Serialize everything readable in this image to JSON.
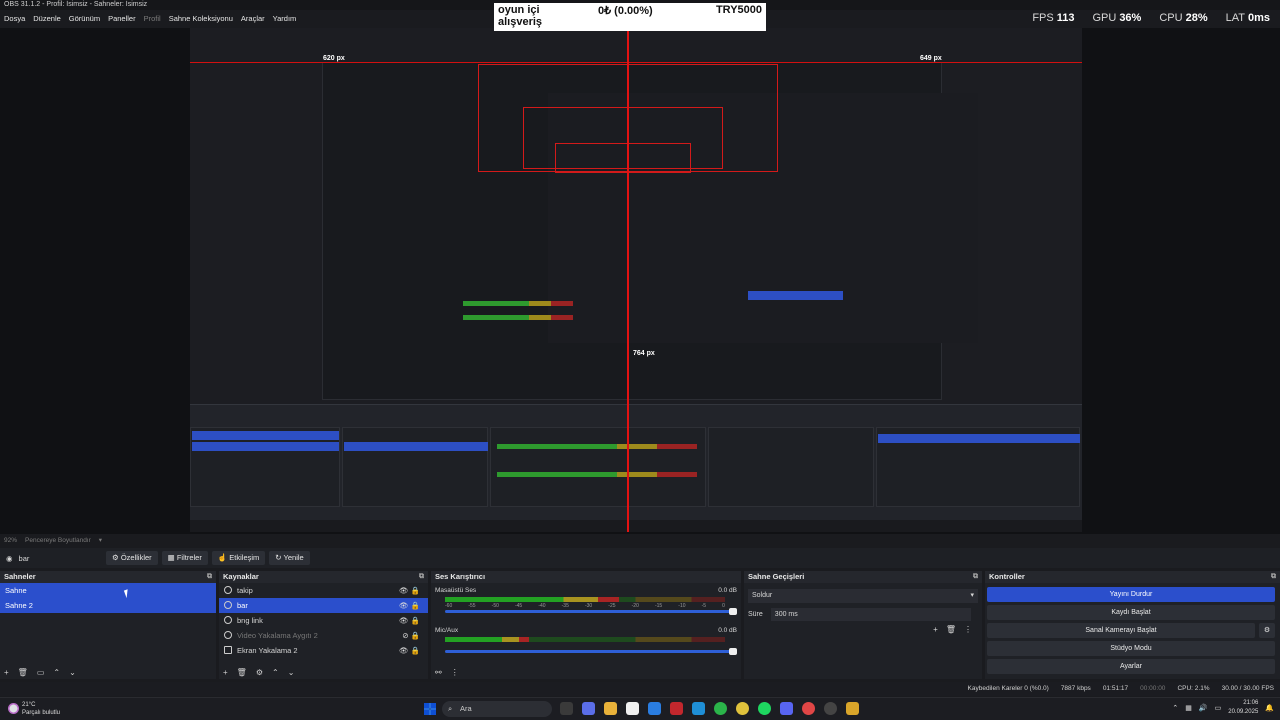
{
  "window": {
    "title": "OBS 31.1.2 - Profil: İsimsiz - Sahneler: İsimsiz"
  },
  "menu": [
    "Dosya",
    "Düzenle",
    "Görünüm",
    "Paneller",
    "Profil",
    "Sahne Koleksiyonu",
    "Araçlar",
    "Yardım"
  ],
  "popup": {
    "label": "oyun içi alışveriş",
    "amount": "0₺ (0.00%)",
    "goal": "TRY5000"
  },
  "stats": {
    "fps_label": "FPS",
    "fps": "113",
    "gpu_label": "GPU",
    "gpu": "36%",
    "cpu_label": "CPU",
    "cpu": "28%",
    "lat_label": "LAT",
    "lat": "0ms"
  },
  "preview": {
    "left_px": "620 px",
    "right_px": "649 px",
    "bottom_px": "764 px"
  },
  "zoom": {
    "level": "92%",
    "mode": "Pencereye Boyutlandır"
  },
  "scene_toolbar": {
    "scene": "bar",
    "properties": "Özellikler",
    "filters": "Filtreler",
    "interact": "Etkileşim",
    "refresh": "Yenile"
  },
  "scenes": {
    "title": "Sahneler",
    "items": [
      "Sahne",
      "Sahne 2"
    ]
  },
  "sources": {
    "title": "Kaynaklar",
    "items": [
      "takip",
      "bar",
      "bng link",
      "Video Yakalama Aygıtı 2",
      "Ekran Yakalama 2"
    ]
  },
  "mixer": {
    "title": "Ses Karıştırıcı",
    "channels": [
      {
        "name": "Masaüstü Ses",
        "db": "0.0 dB",
        "level": 0.62
      },
      {
        "name": "Mic/Aux",
        "db": "0.0 dB",
        "level": 0.3
      }
    ],
    "scale": [
      "-60",
      "-55",
      "-50",
      "-45",
      "-40",
      "-35",
      "-30",
      "-25",
      "-20",
      "-15",
      "-10",
      "-5",
      "0"
    ]
  },
  "transitions": {
    "title": "Sahne Geçişleri",
    "type": "Soldur",
    "duration_label": "Süre",
    "duration": "300 ms"
  },
  "controls": {
    "title": "Kontroller",
    "buttons": [
      "Yayını Durdur",
      "Kaydı Başlat",
      "Sanal Kamerayı Başlat",
      "Stüdyo Modu",
      "Ayarlar"
    ]
  },
  "status": {
    "dropped": "Kaybedilen Kareler 0 (%0.0)",
    "bitrate": "7887 kbps",
    "stream_time": "01:51:17",
    "rec_time": "00:00:00",
    "cpu": "CPU: 2.1%",
    "fps": "30.00 / 30.00 FPS"
  },
  "taskbar": {
    "temp": "21°C",
    "weather": "Parçalı bulutlu",
    "search": "Ara",
    "time": "21:06",
    "date": "20.09.2025"
  },
  "colors": {
    "accent": "#2b4fcc",
    "guide": "#e31212",
    "bg": "#1f2126"
  }
}
